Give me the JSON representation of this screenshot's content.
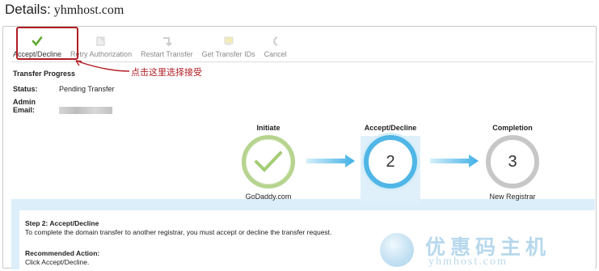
{
  "header": {
    "label": "Details:",
    "domain": "yhmhost.com"
  },
  "toolbar": {
    "items": [
      {
        "label": "Accept/Decline",
        "icon": "checkmark-icon",
        "enabled": true
      },
      {
        "label": "Retry Authorization",
        "icon": "retry-icon",
        "enabled": false
      },
      {
        "label": "Restart Transfer",
        "icon": "restart-icon",
        "enabled": false
      },
      {
        "label": "Get Transfer IDs",
        "icon": "transfer-ids-icon",
        "enabled": false
      },
      {
        "label": "Cancel",
        "icon": "cancel-icon",
        "enabled": false
      }
    ]
  },
  "annotation": {
    "text": "点击这里选择接受",
    "color": "#b01e24"
  },
  "transfer": {
    "title": "Transfer Progress",
    "status_label": "Status:",
    "status_value": "Pending Transfer",
    "email_label": "Admin Email:"
  },
  "steps": [
    {
      "title": "Initiate",
      "content": "✓",
      "subtitle": "GoDaddy.com",
      "state": "done",
      "color": "#b6d48e"
    },
    {
      "title": "Accept/Decline",
      "content": "2",
      "subtitle": "",
      "state": "current",
      "color": "#4fb6e6"
    },
    {
      "title": "Completion",
      "content": "3",
      "subtitle": "New Registrar",
      "state": "pending",
      "color": "#c7c7c7"
    }
  ],
  "details": {
    "step_heading": "Step 2: Accept/Decline",
    "step_text": "To complete the domain transfer to another registrar, you must accept or decline the transfer request.",
    "action_heading": "Recommended Action:",
    "action_text": "Click Accept/Decline."
  },
  "watermark": {
    "text": "优惠码主机",
    "sub": "yhmhost.com"
  }
}
